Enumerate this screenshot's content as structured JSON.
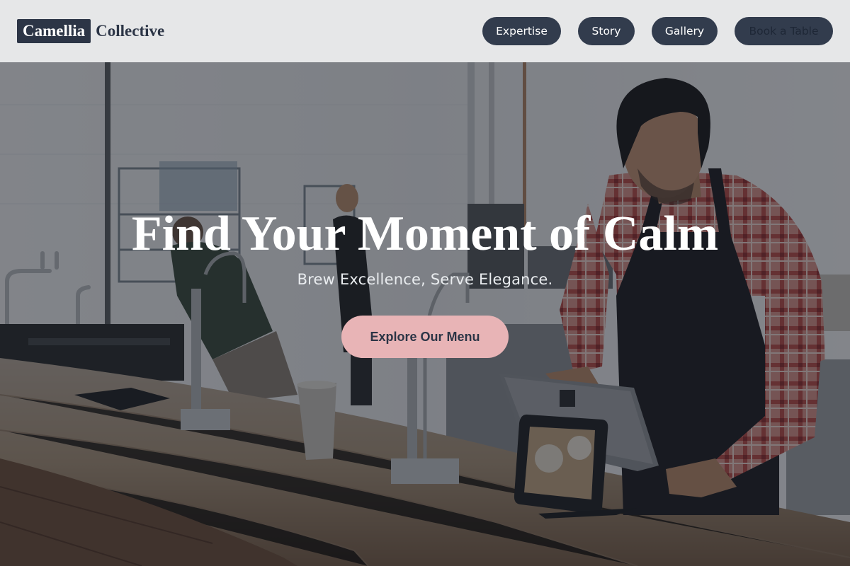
{
  "brand": {
    "highlight": "Camellia",
    "rest": "Collective"
  },
  "nav": {
    "items": [
      {
        "label": "Expertise"
      },
      {
        "label": "Story"
      },
      {
        "label": "Gallery"
      },
      {
        "label": "Book a Table"
      }
    ]
  },
  "hero": {
    "title": "Find Your Moment of Calm",
    "subtitle": "Brew Excellence, Serve Elegance.",
    "cta_label": "Explore Our Menu"
  },
  "colors": {
    "navy": "#2c3546",
    "nav_button": "#323c4d",
    "cta_pink": "#e8b4b6",
    "header_bg": "#e6e7e8"
  }
}
